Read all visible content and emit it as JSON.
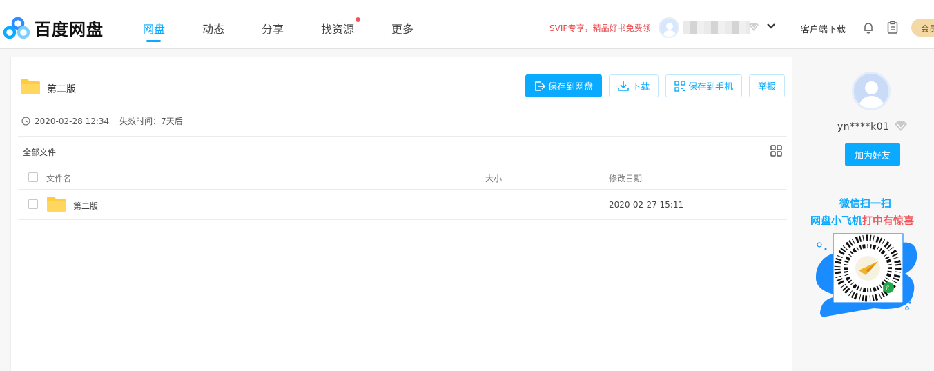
{
  "brand": {
    "name": "百度网盘"
  },
  "nav": {
    "items": [
      {
        "label": "网盘",
        "active": true
      },
      {
        "label": "动态",
        "active": false
      },
      {
        "label": "分享",
        "active": false
      },
      {
        "label": "找资源",
        "active": false,
        "has_dot": true
      },
      {
        "label": "更多",
        "active": false
      }
    ],
    "promo": "SVIP专享，精品好书免费领",
    "client_download": "客户端下载",
    "member_label": "会员"
  },
  "share": {
    "title": "第二版",
    "created": "2020-02-28 12:34",
    "expire": "失效时间：7天后",
    "buttons": {
      "save": "保存到网盘",
      "download": "下载",
      "save_phone": "保存到手机",
      "report": "举报"
    }
  },
  "files": {
    "breadcrumb": "全部文件",
    "columns": {
      "name": "文件名",
      "size": "大小",
      "date": "修改日期"
    },
    "rows": [
      {
        "name": "第二版",
        "size": "-",
        "date": "2020-02-27 15:11"
      }
    ]
  },
  "sidebar": {
    "username": "yn****k01",
    "add_friend": "加为好友",
    "promo_line1": "微信扫一扫",
    "promo_line2_blue": "网盘小飞机",
    "promo_line2_red": "打中有惊喜"
  },
  "colors": {
    "accent": "#09AAFF",
    "alert": "#f2565c",
    "folder": "#ffcc3d"
  }
}
